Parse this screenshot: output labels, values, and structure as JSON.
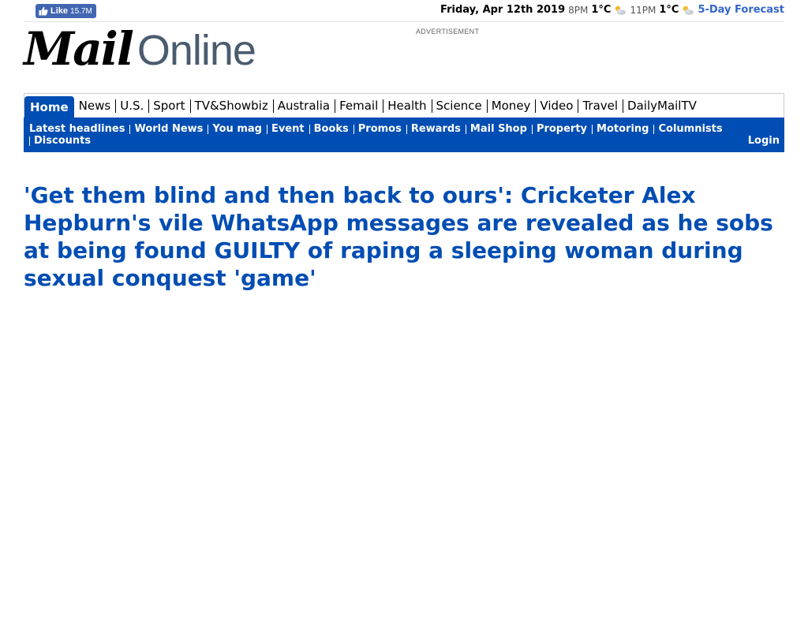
{
  "topbar": {
    "like_label": "Like",
    "like_count": "15.7M",
    "date": "Friday, Apr 12th 2019",
    "weather": [
      {
        "time": "8PM",
        "temp": "1°C",
        "icon": "partly-cloudy-icon"
      },
      {
        "time": "11PM",
        "temp": "1°C",
        "icon": "partly-cloudy-icon"
      }
    ],
    "forecast_link": "5-Day Forecast"
  },
  "logo": {
    "mail": "Mail",
    "online": "Online"
  },
  "advert_label": "ADVERTISEMENT",
  "nav_primary": [
    {
      "label": "Home",
      "active": true
    },
    {
      "label": "News"
    },
    {
      "label": "U.S."
    },
    {
      "label": "Sport"
    },
    {
      "label": "TV&Showbiz"
    },
    {
      "label": "Australia"
    },
    {
      "label": "Femail"
    },
    {
      "label": "Health"
    },
    {
      "label": "Science"
    },
    {
      "label": "Money"
    },
    {
      "label": "Video"
    },
    {
      "label": "Travel"
    },
    {
      "label": "DailyMailTV"
    }
  ],
  "nav_secondary": [
    "Latest headlines",
    "World News",
    "You mag",
    "Event",
    "Books",
    "Promos",
    "Rewards",
    "Mail Shop",
    "Property",
    "Motoring",
    "Columnists",
    "Discounts"
  ],
  "login_label": "Login",
  "article": {
    "headline": "'Get them blind and then back to ours': Cricketer Alex Hepburn's vile WhatsApp messages are revealed as he sobs at being found GUILTY of raping a sleeping woman during sexual conquest 'game'"
  },
  "colors": {
    "brand_blue": "#004db3",
    "fb_blue": "#4267b2",
    "link_blue": "#3366cc"
  }
}
